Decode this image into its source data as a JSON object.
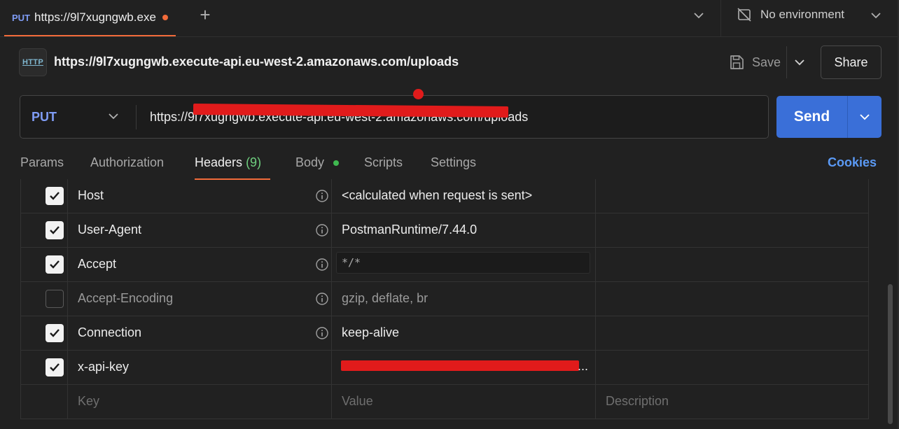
{
  "tab": {
    "method": "PUT",
    "title": "https://9l7xugngwb.exe",
    "unsaved": true
  },
  "environment": {
    "label": "No environment"
  },
  "request": {
    "title": "https://9l7xugngwb.execute-api.eu-west-2.amazonaws.com/uploads",
    "method": "PUT",
    "url": "https://9l7xugngwb.execute-api.eu-west-2.amazonaws.com/uploads",
    "http_icon_label": "HTTP"
  },
  "actions": {
    "save_label": "Save",
    "share_label": "Share",
    "send_label": "Send"
  },
  "subtabs": {
    "params": "Params",
    "authorization": "Authorization",
    "headers": "Headers",
    "headers_count": "(9)",
    "body": "Body",
    "scripts": "Scripts",
    "settings": "Settings",
    "cookies": "Cookies"
  },
  "headers": [
    {
      "enabled": true,
      "key": "Host",
      "value": "<calculated when request is sent>"
    },
    {
      "enabled": true,
      "key": "User-Agent",
      "value": "PostmanRuntime/7.44.0"
    },
    {
      "enabled": true,
      "key": "Accept",
      "value": "*/*"
    },
    {
      "enabled": false,
      "key": "Accept-Encoding",
      "value": "gzip, deflate, br"
    },
    {
      "enabled": true,
      "key": "Connection",
      "value": "keep-alive"
    },
    {
      "enabled": true,
      "key": "x-api-key",
      "value": "..."
    }
  ],
  "new_row": {
    "key_placeholder": "Key",
    "value_placeholder": "Value",
    "description_placeholder": "Description"
  },
  "colors": {
    "accent_orange": "#f26b3a",
    "send_blue": "#3a6fd8",
    "method_blue": "#7f9cf5",
    "cookies_blue": "#5b9af5",
    "body_dot_green": "#3fb950",
    "redaction_red": "#e11b1b"
  }
}
